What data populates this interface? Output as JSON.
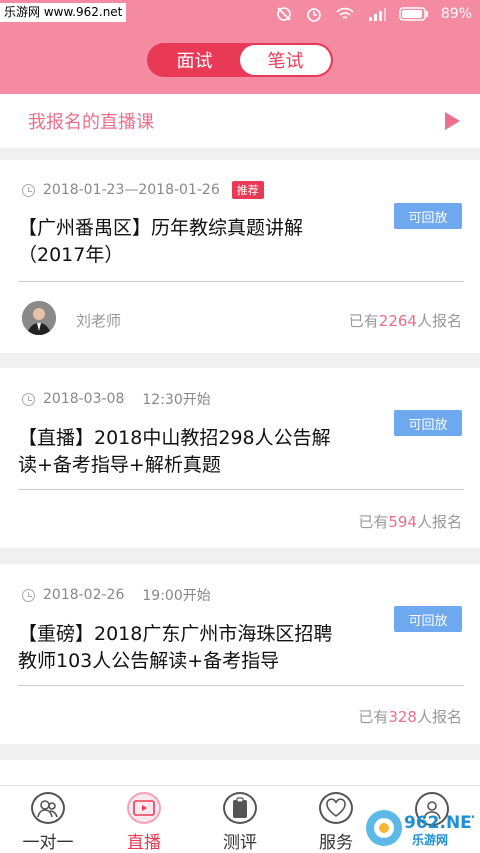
{
  "watermark": "乐游网 www.962.net",
  "statusbar": {
    "battery": "89%",
    "icons": [
      "no-sound-icon",
      "alarm-icon",
      "wifi-icon",
      "signal-icon",
      "battery-icon"
    ]
  },
  "tabs_top": [
    "面试",
    "笔试"
  ],
  "my_courses": {
    "label": "我报名的直播课"
  },
  "courses": [
    {
      "date": "2018-01-23—2018-01-26",
      "tag": "推荐",
      "title": "【广州番禺区】历年教综真题讲解（2017年）",
      "action": "可回放",
      "teacher": "刘老师",
      "count_prefix": "已有",
      "count": "2264",
      "count_suffix": "人报名"
    },
    {
      "date": "2018-03-08",
      "time": "12:30开始",
      "title": "【直播】2018中山教招298人公告解读+备考指导+解析真题",
      "action": "可回放",
      "count_prefix": "已有",
      "count": "594",
      "count_suffix": "人报名"
    },
    {
      "date": "2018-02-26",
      "time": "19:00开始",
      "title": "【重磅】2018广东广州市海珠区招聘教师103人公告解读+备考指导",
      "action": "可回放",
      "count_prefix": "已有",
      "count": "328",
      "count_suffix": "人报名"
    }
  ],
  "bottom_nav": [
    {
      "label": "一对一",
      "icon": "people-icon"
    },
    {
      "label": "直播",
      "icon": "video-icon",
      "active": true
    },
    {
      "label": "测评",
      "icon": "clipboard-icon"
    },
    {
      "label": "服务",
      "icon": "heart-icon"
    },
    {
      "label": "",
      "icon": "profile-icon"
    }
  ],
  "logo": "962.NET",
  "logo_sub": "乐游网",
  "colors": {
    "header": "#f48ba2",
    "accent": "#e83a57",
    "replay": "#6ea9f0",
    "count": "#ec6f8c"
  }
}
